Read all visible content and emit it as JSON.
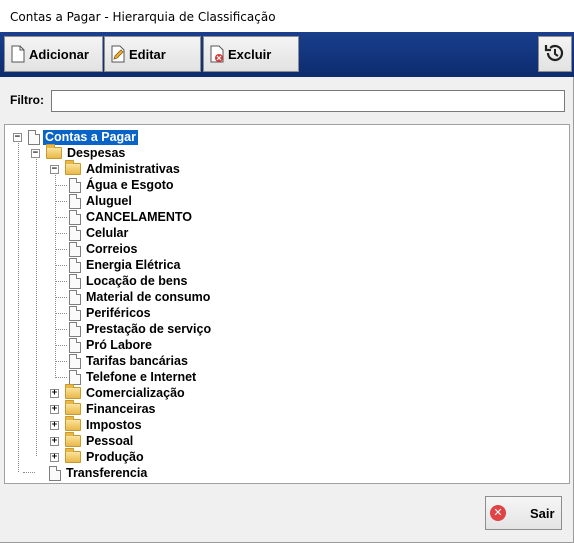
{
  "window": {
    "title": "Contas a Pagar - Hierarquia de Classificação"
  },
  "toolbar": {
    "add_label": "Adicionar",
    "edit_label": "Editar",
    "delete_label": "Excluir",
    "refresh_icon": "refresh-icon",
    "bg_color": "#12357e"
  },
  "filter": {
    "label": "Filtro:",
    "value": ""
  },
  "tree": {
    "root": "Contas a Pagar",
    "despesas": "Despesas",
    "administrativas": "Administrativas",
    "admin_items": [
      "Água e Esgoto",
      "Aluguel",
      "CANCELAMENTO",
      "Celular",
      "Correios",
      "Energia Elétrica",
      "Locação de bens",
      "Material de consumo",
      "Periféricos",
      "Prestação de serviço",
      "Pró Labore",
      "Tarifas bancárias",
      "Telefone e Internet"
    ],
    "collapsed_groups": [
      "Comercialização",
      "Financeiras",
      "Impostos",
      "Pessoal",
      "Produção"
    ],
    "transferencia": "Transferencia",
    "selected_color": "#0a64c8"
  },
  "footer": {
    "close_label": "Sair"
  }
}
